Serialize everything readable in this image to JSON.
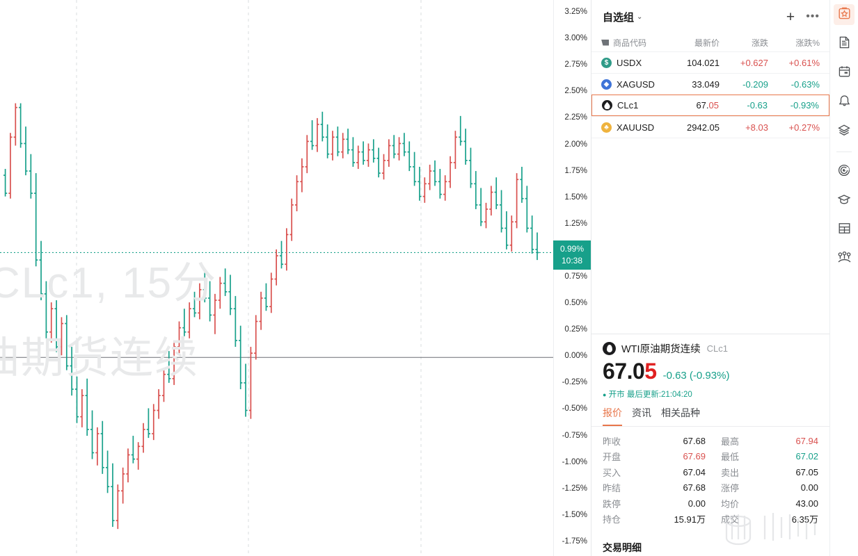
{
  "watchlist": {
    "title": "自选组",
    "chevron": "⌄",
    "add_icon": "plus-icon",
    "more_icon": "more-icon",
    "columns": [
      "商品代码",
      "最新价",
      "涨跌",
      "涨跌%"
    ],
    "rows": [
      {
        "icon": "usd-circle-icon",
        "icon_glyph": "$",
        "icon_color": "#2f9b88",
        "symbol": "USDX",
        "last": "104.021",
        "change": "+0.627",
        "pct": "+0.61%",
        "dir": "up",
        "selected": false
      },
      {
        "icon": "silver-diamond-icon",
        "icon_glyph": "◆",
        "icon_color": "#3f74d8",
        "symbol": "XAGUSD",
        "last": "33.049",
        "change": "-0.209",
        "pct": "-0.63%",
        "dir": "down",
        "selected": false
      },
      {
        "icon": "oil-drop-icon",
        "icon_glyph": "",
        "icon_color": "#1d1d1f",
        "symbol": "CLc1",
        "last": "67.05",
        "change": "-0.63",
        "pct": "-0.93%",
        "dir": "down",
        "selected": true
      },
      {
        "icon": "gold-circle-icon",
        "icon_glyph": "♣",
        "icon_color": "#efb33e",
        "symbol": "XAUUSD",
        "last": "2942.05",
        "change": "+8.03",
        "pct": "+0.27%",
        "dir": "up",
        "selected": false
      }
    ]
  },
  "detail": {
    "instrument_icon": "oil-drop-icon",
    "name": "WTI原油期货连续",
    "code": "CLc1",
    "price_main": "67.0",
    "price_tail": "5",
    "delta": "-0.63 (-0.93%)",
    "status_dot": "●",
    "status": "开市 最后更新:21:04:20",
    "tabs": [
      {
        "label": "报价",
        "active": true
      },
      {
        "label": "资讯",
        "active": false
      },
      {
        "label": "相关品种",
        "active": false
      }
    ],
    "table": [
      {
        "k1": "昨收",
        "v1": "67.68",
        "c1": "neutral",
        "k2": "最高",
        "v2": "67.94",
        "c2": "up"
      },
      {
        "k1": "开盘",
        "v1": "67.69",
        "c1": "up",
        "k2": "最低",
        "v2": "67.02",
        "c2": "down"
      },
      {
        "k1": "买入",
        "v1": "67.04",
        "c1": "neutral",
        "k2": "卖出",
        "v2": "67.05",
        "c2": "neutral"
      },
      {
        "k1": "昨结",
        "v1": "67.68",
        "c1": "neutral",
        "k2": "涨停",
        "v2": "0.00",
        "c2": "neutral"
      },
      {
        "k1": "跌停",
        "v1": "0.00",
        "c1": "neutral",
        "k2": "均价",
        "v2": "43.00",
        "c2": "neutral"
      },
      {
        "k1": "持仓",
        "v1": "15.91万",
        "c1": "neutral",
        "k2": "成交",
        "v2": "6.35万",
        "c2": "neutral"
      }
    ],
    "footer": "交易明细"
  },
  "rail": {
    "items": [
      {
        "icon": "watchlist-star-icon",
        "active": true
      },
      {
        "icon": "news-document-icon",
        "active": false
      },
      {
        "icon": "calendar-icon",
        "active": false
      },
      {
        "icon": "bell-icon",
        "active": false
      },
      {
        "icon": "layers-icon",
        "active": false
      },
      {
        "icon": "radar-icon",
        "active": false
      },
      {
        "icon": "graduation-cap-icon",
        "active": false
      },
      {
        "icon": "table-grid-icon",
        "active": false
      },
      {
        "icon": "network-nodes-icon",
        "active": false
      }
    ]
  },
  "chart_data": {
    "type": "line",
    "subtype": "ohlc-bar",
    "title": "CLc1, 15分",
    "watermark_line1": "CLc1, 15分",
    "watermark_line2": "油期货连续",
    "xlabel": "",
    "ylabel": "",
    "ylim": [
      -1.875,
      3.375
    ],
    "ytick_unit": "%",
    "yticks": [
      3.25,
      3.0,
      2.75,
      2.5,
      2.25,
      2.0,
      1.75,
      1.5,
      1.25,
      1.0,
      0.75,
      0.5,
      0.25,
      0.0,
      -0.25,
      -0.5,
      -0.75,
      -1.0,
      -1.25,
      -1.5,
      -1.75
    ],
    "ytick_labels": [
      "3.25%",
      "3.00%",
      "2.75%",
      "2.50%",
      "2.25%",
      "2.00%",
      "1.75%",
      "1.50%",
      "1.25%",
      "1.00%",
      "0.75%",
      "0.50%",
      "0.25%",
      "0.00%",
      "-0.25%",
      "-0.50%",
      "-0.75%",
      "-1.00%",
      "-1.25%",
      "-1.50%",
      "-1.75%"
    ],
    "grid": {
      "horizontal": false,
      "vertical_dashed_at_x": [
        110,
        357,
        605
      ],
      "zero_line": 0.0
    },
    "current_price_marker": {
      "value": 0.99,
      "label": "0.99%",
      "time": "10:38",
      "color": "#17a08a"
    },
    "up_color": "#d9504e",
    "down_color": "#17a08a",
    "bars": [
      {
        "o": 1.72,
        "h": 1.78,
        "l": 1.52,
        "c": 1.55,
        "d": "down"
      },
      {
        "o": 1.55,
        "h": 2.12,
        "l": 1.5,
        "c": 2.08,
        "d": "up"
      },
      {
        "o": 2.08,
        "h": 2.4,
        "l": 2.0,
        "c": 2.36,
        "d": "up"
      },
      {
        "o": 2.36,
        "h": 2.4,
        "l": 1.98,
        "c": 2.02,
        "d": "down"
      },
      {
        "o": 2.02,
        "h": 2.18,
        "l": 1.72,
        "c": 1.76,
        "d": "down"
      },
      {
        "o": 1.76,
        "h": 1.92,
        "l": 1.5,
        "c": 1.55,
        "d": "down"
      },
      {
        "o": 1.55,
        "h": 1.74,
        "l": 0.86,
        "c": 0.92,
        "d": "down"
      },
      {
        "o": 0.92,
        "h": 1.1,
        "l": 0.54,
        "c": 0.6,
        "d": "down"
      },
      {
        "o": 0.6,
        "h": 0.72,
        "l": 0.18,
        "c": 0.24,
        "d": "down"
      },
      {
        "o": 0.24,
        "h": 0.52,
        "l": 0.14,
        "c": 0.46,
        "d": "up"
      },
      {
        "o": 0.46,
        "h": 0.54,
        "l": 0.05,
        "c": 0.1,
        "d": "down"
      },
      {
        "o": 0.1,
        "h": 0.38,
        "l": 0.02,
        "c": 0.32,
        "d": "up"
      },
      {
        "o": 0.32,
        "h": 0.4,
        "l": -0.12,
        "c": -0.08,
        "d": "down"
      },
      {
        "o": -0.08,
        "h": 0.1,
        "l": -0.36,
        "c": -0.3,
        "d": "down"
      },
      {
        "o": -0.3,
        "h": -0.18,
        "l": -0.62,
        "c": -0.56,
        "d": "down"
      },
      {
        "o": -0.56,
        "h": -0.3,
        "l": -0.66,
        "c": -0.36,
        "d": "up"
      },
      {
        "o": -0.36,
        "h": -0.2,
        "l": -0.74,
        "c": -0.68,
        "d": "down"
      },
      {
        "o": -0.68,
        "h": -0.5,
        "l": -0.96,
        "c": -0.9,
        "d": "down"
      },
      {
        "o": -0.9,
        "h": -0.66,
        "l": -1.02,
        "c": -0.72,
        "d": "up"
      },
      {
        "o": -0.72,
        "h": -0.6,
        "l": -1.1,
        "c": -1.04,
        "d": "down"
      },
      {
        "o": -1.04,
        "h": -0.88,
        "l": -1.28,
        "c": -1.22,
        "d": "down"
      },
      {
        "o": -1.22,
        "h": -1.0,
        "l": -1.6,
        "c": -1.54,
        "d": "down"
      },
      {
        "o": -1.54,
        "h": -1.2,
        "l": -1.62,
        "c": -1.26,
        "d": "up"
      },
      {
        "o": -1.26,
        "h": -1.04,
        "l": -1.38,
        "c": -1.1,
        "d": "up"
      },
      {
        "o": -1.1,
        "h": -0.86,
        "l": -1.18,
        "c": -0.92,
        "d": "up"
      },
      {
        "o": -0.92,
        "h": -0.74,
        "l": -1.0,
        "c": -0.96,
        "d": "down"
      },
      {
        "o": -0.96,
        "h": -0.8,
        "l": -1.06,
        "c": -0.84,
        "d": "up"
      },
      {
        "o": -0.84,
        "h": -0.62,
        "l": -0.9,
        "c": -0.68,
        "d": "up"
      },
      {
        "o": -0.68,
        "h": -0.48,
        "l": -0.76,
        "c": -0.72,
        "d": "down"
      },
      {
        "o": -0.72,
        "h": -0.44,
        "l": -0.78,
        "c": -0.5,
        "d": "up"
      },
      {
        "o": -0.5,
        "h": -0.3,
        "l": -0.58,
        "c": -0.36,
        "d": "up"
      },
      {
        "o": -0.36,
        "h": -0.1,
        "l": -0.42,
        "c": -0.16,
        "d": "up"
      },
      {
        "o": -0.16,
        "h": 0.06,
        "l": -0.24,
        "c": -0.2,
        "d": "down"
      },
      {
        "o": -0.2,
        "h": 0.16,
        "l": -0.26,
        "c": 0.1,
        "d": "up"
      },
      {
        "o": 0.1,
        "h": 0.34,
        "l": 0.04,
        "c": 0.28,
        "d": "up"
      },
      {
        "o": 0.28,
        "h": 0.46,
        "l": 0.2,
        "c": 0.24,
        "d": "down"
      },
      {
        "o": 0.24,
        "h": 0.52,
        "l": 0.18,
        "c": 0.46,
        "d": "up"
      },
      {
        "o": 0.46,
        "h": 0.62,
        "l": 0.38,
        "c": 0.42,
        "d": "down"
      },
      {
        "o": 0.42,
        "h": 0.7,
        "l": 0.36,
        "c": 0.64,
        "d": "up"
      },
      {
        "o": 0.64,
        "h": 0.8,
        "l": 0.52,
        "c": 0.56,
        "d": "down"
      },
      {
        "o": 0.56,
        "h": 0.72,
        "l": 0.34,
        "c": 0.4,
        "d": "down"
      },
      {
        "o": 0.4,
        "h": 0.6,
        "l": 0.22,
        "c": 0.54,
        "d": "up"
      },
      {
        "o": 0.54,
        "h": 0.76,
        "l": 0.46,
        "c": 0.7,
        "d": "up"
      },
      {
        "o": 0.7,
        "h": 0.84,
        "l": 0.58,
        "c": 0.62,
        "d": "down"
      },
      {
        "o": 0.62,
        "h": 0.78,
        "l": 0.4,
        "c": 0.46,
        "d": "down"
      },
      {
        "o": 0.46,
        "h": 0.58,
        "l": 0.1,
        "c": 0.16,
        "d": "down"
      },
      {
        "o": 0.16,
        "h": 0.3,
        "l": -0.3,
        "c": -0.24,
        "d": "down"
      },
      {
        "o": -0.24,
        "h": -0.06,
        "l": -0.56,
        "c": -0.5,
        "d": "down"
      },
      {
        "o": -0.5,
        "h": 0.1,
        "l": -0.58,
        "c": 0.04,
        "d": "up"
      },
      {
        "o": 0.04,
        "h": 0.4,
        "l": -0.02,
        "c": 0.34,
        "d": "up"
      },
      {
        "o": 0.34,
        "h": 0.62,
        "l": 0.26,
        "c": 0.56,
        "d": "up"
      },
      {
        "o": 0.56,
        "h": 0.7,
        "l": 0.44,
        "c": 0.48,
        "d": "down"
      },
      {
        "o": 0.48,
        "h": 0.8,
        "l": 0.42,
        "c": 0.74,
        "d": "up"
      },
      {
        "o": 0.74,
        "h": 1.02,
        "l": 0.68,
        "c": 0.96,
        "d": "up"
      },
      {
        "o": 0.96,
        "h": 1.1,
        "l": 0.84,
        "c": 0.88,
        "d": "down"
      },
      {
        "o": 0.88,
        "h": 1.22,
        "l": 0.82,
        "c": 1.16,
        "d": "up"
      },
      {
        "o": 1.16,
        "h": 1.5,
        "l": 1.1,
        "c": 1.44,
        "d": "up"
      },
      {
        "o": 1.44,
        "h": 1.72,
        "l": 1.38,
        "c": 1.66,
        "d": "up"
      },
      {
        "o": 1.66,
        "h": 1.88,
        "l": 1.56,
        "c": 1.8,
        "d": "up"
      },
      {
        "o": 1.8,
        "h": 2.1,
        "l": 1.74,
        "c": 2.04,
        "d": "up"
      },
      {
        "o": 2.04,
        "h": 2.24,
        "l": 1.96,
        "c": 2.0,
        "d": "down"
      },
      {
        "o": 2.0,
        "h": 2.26,
        "l": 1.94,
        "c": 2.2,
        "d": "up"
      },
      {
        "o": 2.2,
        "h": 2.32,
        "l": 2.04,
        "c": 2.08,
        "d": "down"
      },
      {
        "o": 2.08,
        "h": 2.2,
        "l": 1.88,
        "c": 1.92,
        "d": "down"
      },
      {
        "o": 1.92,
        "h": 2.14,
        "l": 1.86,
        "c": 2.08,
        "d": "up"
      },
      {
        "o": 2.08,
        "h": 2.18,
        "l": 1.9,
        "c": 1.94,
        "d": "down"
      },
      {
        "o": 1.94,
        "h": 2.12,
        "l": 1.88,
        "c": 2.06,
        "d": "up"
      },
      {
        "o": 2.06,
        "h": 2.16,
        "l": 1.92,
        "c": 1.96,
        "d": "down"
      },
      {
        "o": 1.96,
        "h": 2.08,
        "l": 1.8,
        "c": 1.84,
        "d": "down"
      },
      {
        "o": 1.84,
        "h": 2.0,
        "l": 1.78,
        "c": 1.94,
        "d": "up"
      },
      {
        "o": 1.94,
        "h": 2.04,
        "l": 1.82,
        "c": 1.86,
        "d": "down"
      },
      {
        "o": 1.86,
        "h": 2.02,
        "l": 1.8,
        "c": 1.96,
        "d": "up"
      },
      {
        "o": 1.96,
        "h": 2.06,
        "l": 1.84,
        "c": 1.88,
        "d": "down"
      },
      {
        "o": 1.88,
        "h": 1.98,
        "l": 1.7,
        "c": 1.74,
        "d": "down"
      },
      {
        "o": 1.74,
        "h": 1.92,
        "l": 1.68,
        "c": 1.86,
        "d": "up"
      },
      {
        "o": 1.86,
        "h": 2.06,
        "l": 1.8,
        "c": 2.0,
        "d": "up"
      },
      {
        "o": 2.0,
        "h": 2.1,
        "l": 1.88,
        "c": 1.92,
        "d": "down"
      },
      {
        "o": 1.92,
        "h": 2.08,
        "l": 1.86,
        "c": 2.02,
        "d": "up"
      },
      {
        "o": 2.02,
        "h": 2.12,
        "l": 1.9,
        "c": 1.94,
        "d": "down"
      },
      {
        "o": 1.94,
        "h": 2.04,
        "l": 1.76,
        "c": 1.8,
        "d": "down"
      },
      {
        "o": 1.8,
        "h": 1.94,
        "l": 1.62,
        "c": 1.66,
        "d": "down"
      },
      {
        "o": 1.66,
        "h": 1.8,
        "l": 1.48,
        "c": 1.52,
        "d": "down"
      },
      {
        "o": 1.52,
        "h": 1.7,
        "l": 1.46,
        "c": 1.64,
        "d": "up"
      },
      {
        "o": 1.64,
        "h": 1.82,
        "l": 1.58,
        "c": 1.76,
        "d": "up"
      },
      {
        "o": 1.76,
        "h": 1.86,
        "l": 1.62,
        "c": 1.66,
        "d": "down"
      },
      {
        "o": 1.66,
        "h": 1.78,
        "l": 1.5,
        "c": 1.54,
        "d": "down"
      },
      {
        "o": 1.54,
        "h": 1.72,
        "l": 1.48,
        "c": 1.66,
        "d": "up"
      },
      {
        "o": 1.66,
        "h": 1.9,
        "l": 1.6,
        "c": 1.84,
        "d": "up"
      },
      {
        "o": 1.84,
        "h": 2.14,
        "l": 1.78,
        "c": 2.08,
        "d": "up"
      },
      {
        "o": 2.08,
        "h": 2.28,
        "l": 2.0,
        "c": 2.04,
        "d": "down"
      },
      {
        "o": 2.04,
        "h": 2.16,
        "l": 1.82,
        "c": 1.86,
        "d": "down"
      },
      {
        "o": 1.86,
        "h": 1.98,
        "l": 1.6,
        "c": 1.64,
        "d": "down"
      },
      {
        "o": 1.64,
        "h": 1.76,
        "l": 1.4,
        "c": 1.44,
        "d": "down"
      },
      {
        "o": 1.44,
        "h": 1.6,
        "l": 1.24,
        "c": 1.28,
        "d": "down"
      },
      {
        "o": 1.28,
        "h": 1.46,
        "l": 1.22,
        "c": 1.4,
        "d": "up"
      },
      {
        "o": 1.4,
        "h": 1.62,
        "l": 1.34,
        "c": 1.56,
        "d": "up"
      },
      {
        "o": 1.56,
        "h": 1.7,
        "l": 1.4,
        "c": 1.44,
        "d": "down"
      },
      {
        "o": 1.44,
        "h": 1.58,
        "l": 1.18,
        "c": 1.22,
        "d": "down"
      },
      {
        "o": 1.22,
        "h": 1.38,
        "l": 1.02,
        "c": 1.06,
        "d": "down"
      },
      {
        "o": 1.06,
        "h": 1.34,
        "l": 1.0,
        "c": 1.28,
        "d": "up"
      },
      {
        "o": 1.28,
        "h": 1.74,
        "l": 1.22,
        "c": 1.68,
        "d": "up"
      },
      {
        "o": 1.68,
        "h": 1.8,
        "l": 1.46,
        "c": 1.5,
        "d": "down"
      },
      {
        "o": 1.5,
        "h": 1.62,
        "l": 1.18,
        "c": 1.22,
        "d": "down"
      },
      {
        "o": 1.22,
        "h": 1.34,
        "l": 0.98,
        "c": 1.02,
        "d": "down"
      },
      {
        "o": 1.02,
        "h": 1.18,
        "l": 0.92,
        "c": 0.99,
        "d": "down"
      }
    ]
  }
}
